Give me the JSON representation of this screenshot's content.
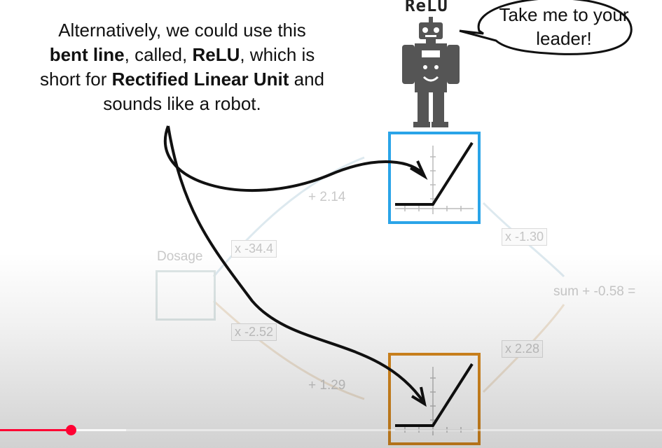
{
  "caption": {
    "line1": "Alternatively, we could use this",
    "line2_bold": "bent line",
    "line2_rest1": ", called, ",
    "line2_bold2": "ReLU",
    "line2_rest2": ", which is",
    "line3_pre": "short for ",
    "line3_bold": "Rectified Linear Unit",
    "line3_post": " and",
    "line4": "sounds like a robot."
  },
  "robot": {
    "title": "ReLU",
    "speech": "Take me to your leader!"
  },
  "network": {
    "input_label": "Dosage",
    "w1": "x -34.4",
    "b1": "+ 2.14",
    "w2": "x -2.52",
    "b2": "+ 1.29",
    "w3": "x -1.30",
    "w4": "x 2.28",
    "sum": "sum + -0.58 ="
  },
  "colors": {
    "top_node": "#2aa4e8",
    "bottom_node": "#d98a1f",
    "progress": "#ff0033"
  },
  "player": {
    "progress": 0.107,
    "buffered": 0.19
  }
}
